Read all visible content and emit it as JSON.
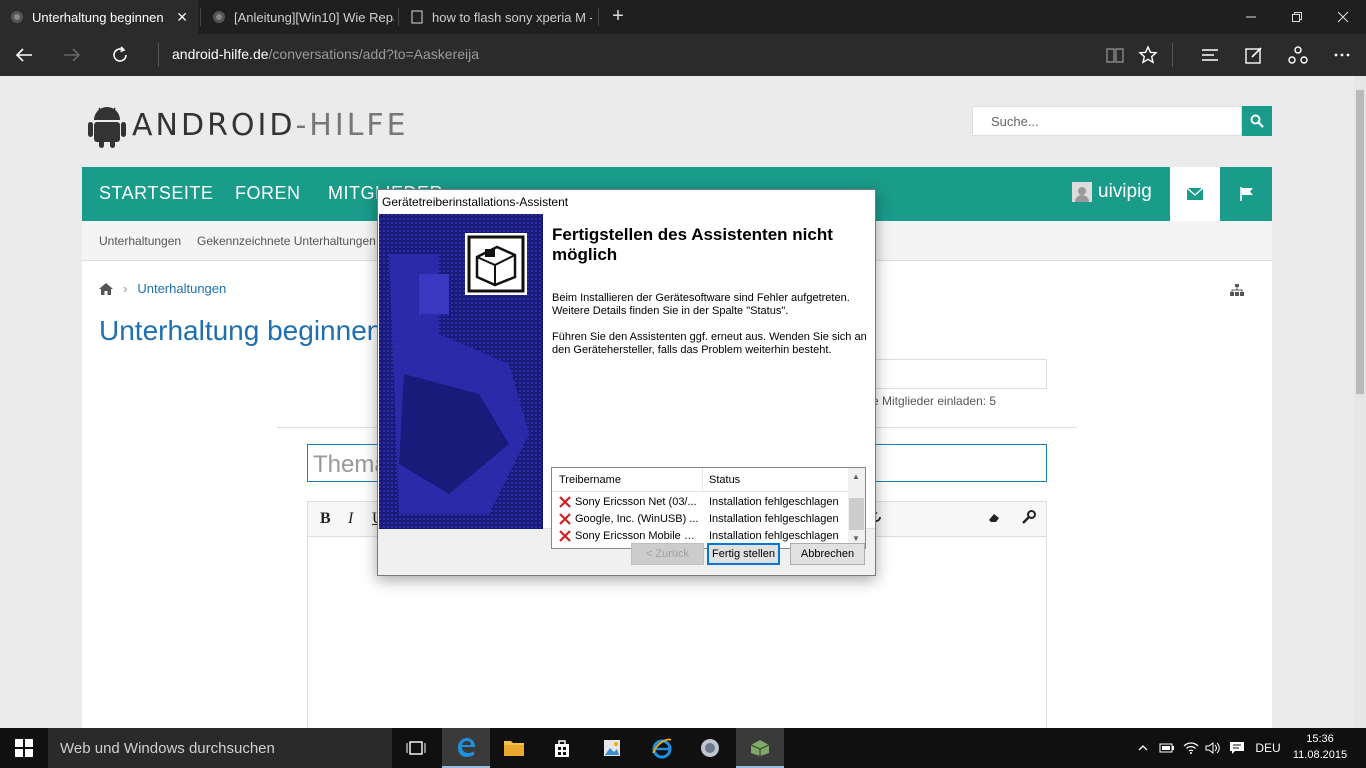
{
  "browser": {
    "tabs": [
      {
        "label": "Unterhaltung beginnen",
        "active": true
      },
      {
        "label": "[Anleitung][Win10] Wie Repa",
        "active": false
      },
      {
        "label": "how to flash sony xperia M -",
        "active": false
      }
    ],
    "new_tab": "+",
    "close_tab": "✕",
    "url_domain": "android-hilfe.de",
    "url_path": "/conversations/add?to=Aaskereija"
  },
  "site": {
    "logo_text_bold": "ANDROID",
    "logo_text_light": "-HILFE",
    "search_placeholder": "Suche...",
    "nav": [
      "STARTSEITE",
      "FOREN",
      "MITGLIEDER"
    ],
    "username": "uivipig",
    "subnav": [
      "Unterhaltungen",
      "Gekennzeichnete Unterhaltungen"
    ],
    "breadcrumb": "Unterhaltungen",
    "page_title": "Unterhaltung beginnen",
    "invite_text": "e Mitglieder einladen: 5",
    "thema_placeholder": "Thema",
    "editor_buttons": [
      "B",
      "I",
      "U"
    ]
  },
  "dialog": {
    "title": "Gerätetreiberinstallations-Assistent",
    "heading": "Fertigstellen des Assistenten nicht möglich",
    "text1": "Beim Installieren der Gerätesoftware sind Fehler aufgetreten. Weitere Details finden Sie in der Spalte \"Status\".",
    "text2": "Führen Sie den Assistenten ggf. erneut aus. Wenden Sie sich an den Gerätehersteller, falls das Problem weiterhin besteht.",
    "columns": [
      "Treibername",
      "Status"
    ],
    "drivers": [
      {
        "name": "Sony Ericsson Net  (03/...",
        "status": "Installation fehlgeschlagen"
      },
      {
        "name": "Google, Inc. (WinUSB) ...",
        "status": "Installation fehlgeschlagen"
      },
      {
        "name": "Sony Ericsson Mobile Co...",
        "status": "Installation fehlgeschlagen"
      }
    ],
    "back_label": "< Zurück",
    "finish_label": "Fertig stellen",
    "cancel_label": "Abbrechen"
  },
  "taskbar": {
    "search_placeholder": "Web und Windows durchsuchen",
    "language": "DEU",
    "time": "15:36",
    "date": "11.08.2015"
  },
  "colors": {
    "brand_teal": "#1a9c8b",
    "link_blue": "#1e6fb0",
    "dialog_banner": "#1a1a7a"
  }
}
